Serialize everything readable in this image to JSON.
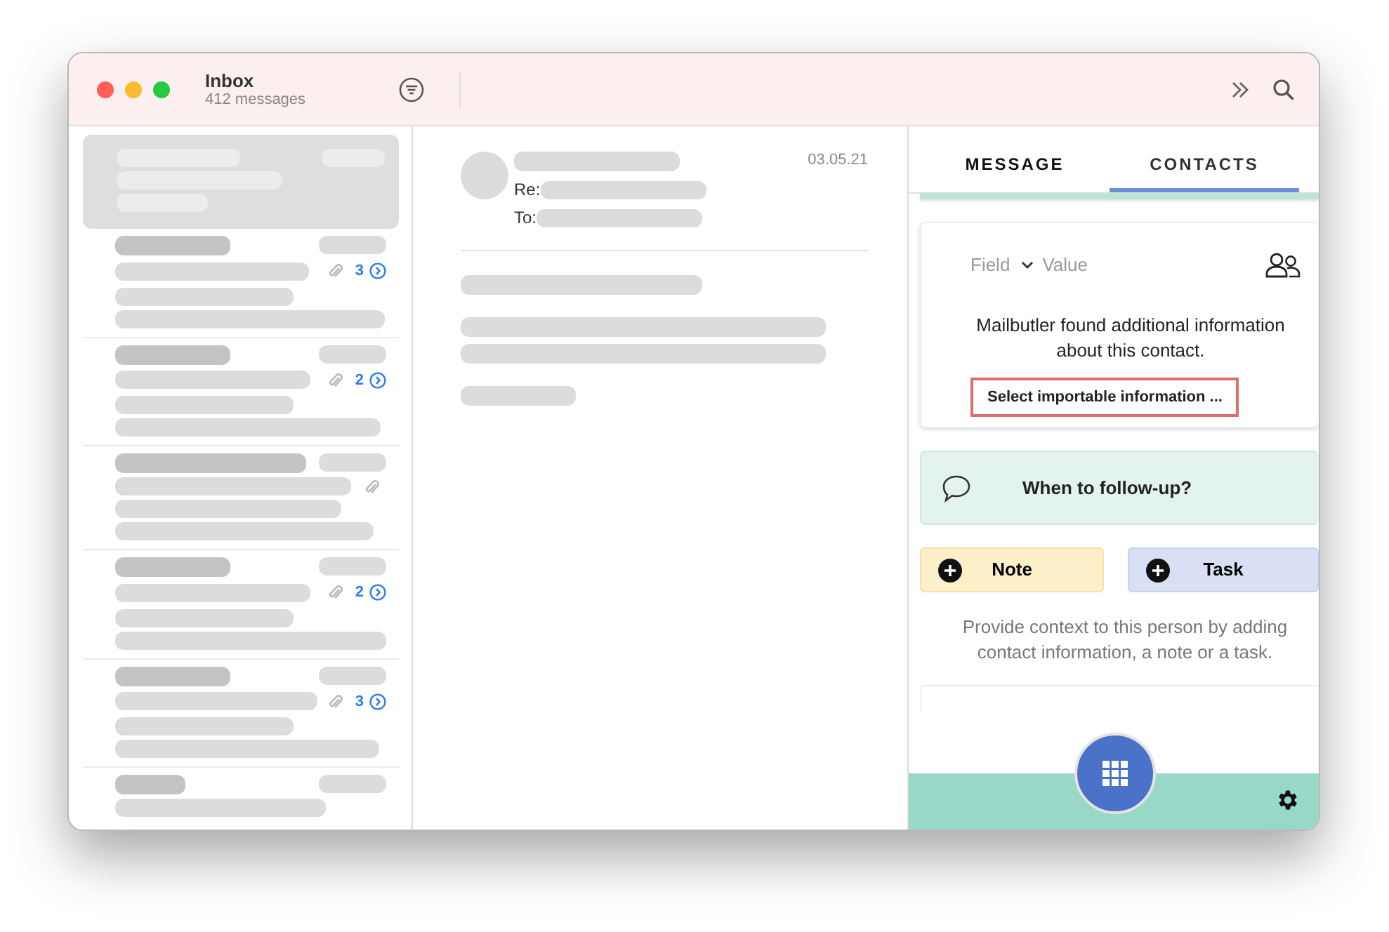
{
  "window": {
    "title": "Inbox",
    "subtitle": "412 messages"
  },
  "messages": [
    {
      "selected": true,
      "attachment": false
    },
    {
      "selected": false,
      "attachment": true,
      "thread_count": "3"
    },
    {
      "selected": false,
      "attachment": true,
      "thread_count": "2"
    },
    {
      "selected": false,
      "attachment": true
    },
    {
      "selected": false,
      "attachment": true,
      "thread_count": "2"
    },
    {
      "selected": false,
      "attachment": true,
      "thread_count": "3"
    },
    {
      "selected": false,
      "attachment": false
    }
  ],
  "reader": {
    "date": "03.05.21",
    "re_label": "Re:",
    "to_label": "To:"
  },
  "panel": {
    "tabs": [
      {
        "label": "MESSAGE",
        "selected": false
      },
      {
        "label": "CONTACTS",
        "selected": true
      }
    ],
    "contact_card": {
      "field_placeholder": "Field",
      "value_placeholder": "Value",
      "notice": "Mailbutler found additional information about this contact.",
      "import_button": "Select importable information ..."
    },
    "follow_up": "When to follow-up?",
    "actions": [
      {
        "kind": "note",
        "label": "Note"
      },
      {
        "kind": "task",
        "label": "Task"
      }
    ],
    "hint": "Provide context to this person by adding contact information, a note or a task."
  }
}
